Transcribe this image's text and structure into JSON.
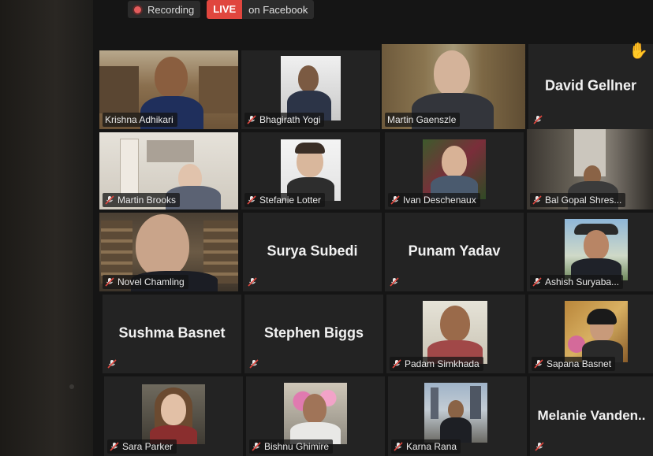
{
  "top_bar": {
    "recording_label": "Recording",
    "live_label": "LIVE",
    "live_destination": "on Facebook"
  },
  "participants": [
    {
      "name": "Krishna Adhikari"
    },
    {
      "name": "Bhagirath Yogi"
    },
    {
      "name": "Martin Gaenszle"
    },
    {
      "name": "David Gellner"
    },
    {
      "name": "Martin Brooks"
    },
    {
      "name": "Stefanie Lotter"
    },
    {
      "name": "Ivan Deschenaux"
    },
    {
      "name": "Bal Gopal Shres..."
    },
    {
      "name": "Novel Chamling"
    },
    {
      "name": "Surya Subedi"
    },
    {
      "name": "Punam Yadav"
    },
    {
      "name": "Ashish Suryaba..."
    },
    {
      "name": "Sushma Basnet"
    },
    {
      "name": "Stephen Biggs"
    },
    {
      "name": "Padam Simkhada"
    },
    {
      "name": "Sapana Basnet"
    },
    {
      "name": "Sara Parker"
    },
    {
      "name": "Bishnu Ghimire"
    },
    {
      "name": "Karna Rana"
    },
    {
      "name": "Melanie  Vanden.."
    }
  ],
  "colors": {
    "active_speaker_border": "#d9d85a",
    "live_badge": "#e0463e",
    "muted_mic": "#e0463e"
  }
}
